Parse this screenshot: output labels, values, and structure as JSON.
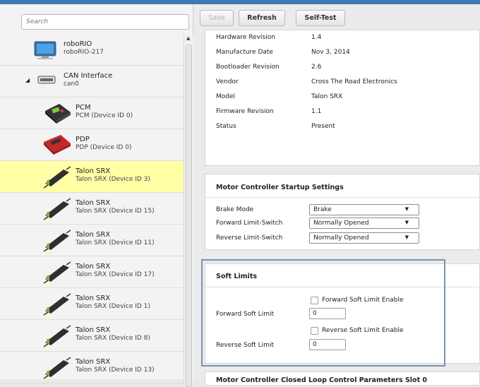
{
  "search": {
    "placeholder": "Search"
  },
  "toolbar": {
    "save": "Save",
    "refresh": "Refresh",
    "selftest": "Self-Test"
  },
  "devices": [
    {
      "name": "roboRIO",
      "sub": "roboRIO-217",
      "icon": "roborio-icon"
    },
    {
      "name": "CAN Interface",
      "sub": "can0",
      "icon": "can-interface-icon"
    },
    {
      "name": "PCM",
      "sub": "PCM (Device ID 0)",
      "icon": "pcm-icon"
    },
    {
      "name": "PDP",
      "sub": "PDP (Device ID 0)",
      "icon": "pdp-icon"
    },
    {
      "name": "Talon SRX",
      "sub": "Talon SRX (Device ID 3)",
      "icon": "talon-srx-icon",
      "selected": true
    },
    {
      "name": "Talon SRX",
      "sub": "Talon SRX (Device ID 15)",
      "icon": "talon-srx-icon"
    },
    {
      "name": "Talon SRX",
      "sub": "Talon SRX (Device ID 11)",
      "icon": "talon-srx-icon"
    },
    {
      "name": "Talon SRX",
      "sub": "Talon SRX (Device ID 17)",
      "icon": "talon-srx-icon"
    },
    {
      "name": "Talon SRX",
      "sub": "Talon SRX (Device ID 1)",
      "icon": "talon-srx-icon"
    },
    {
      "name": "Talon SRX",
      "sub": "Talon SRX (Device ID 8)",
      "icon": "talon-srx-icon"
    },
    {
      "name": "Talon SRX",
      "sub": "Talon SRX (Device ID 13)",
      "icon": "talon-srx-icon"
    }
  ],
  "info": {
    "rows": [
      {
        "label": "Hardware Revision",
        "value": "1.4"
      },
      {
        "label": "Manufacture Date",
        "value": "Nov 3, 2014"
      },
      {
        "label": "Bootloader Revision",
        "value": "2.6"
      },
      {
        "label": "Vendor",
        "value": "Cross The Road Electronics"
      },
      {
        "label": "Model",
        "value": "Talon SRX"
      },
      {
        "label": "Firmware Revision",
        "value": "1.1"
      },
      {
        "label": "Status",
        "value": "Present"
      }
    ]
  },
  "startup": {
    "title": "Motor Controller Startup Settings",
    "rows": [
      {
        "label": "Brake Mode",
        "value": "Brake"
      },
      {
        "label": "Forward Limit-Switch",
        "value": "Normally Opened"
      },
      {
        "label": "Reverse Limit-Switch",
        "value": "Normally Opened"
      }
    ]
  },
  "soft": {
    "title": "Soft Limits",
    "fwd_enable": "Forward Soft Limit Enable",
    "fwd_label": "Forward Soft Limit",
    "fwd_value": "0",
    "rev_enable": "Reverse Soft Limit Enable",
    "rev_label": "Reverse Soft Limit",
    "rev_value": "0"
  },
  "next_panel": {
    "title": "Motor Controller Closed Loop Control Parameters Slot 0"
  },
  "colors": {
    "accent": "#3f78b2",
    "selected": "#ffffa6",
    "highlight_border": "#7a93b3"
  }
}
